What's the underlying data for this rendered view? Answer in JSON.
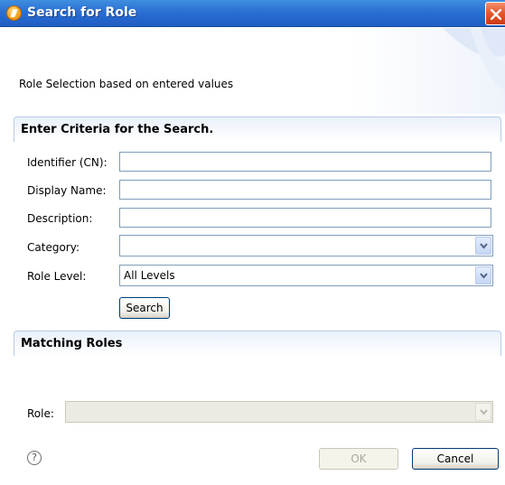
{
  "window": {
    "title": "Search for Role"
  },
  "intro": "Role Selection based on entered values",
  "criteria": {
    "header": "Enter Criteria for the Search.",
    "identifier_label": "Identifier (CN):",
    "identifier_value": "",
    "display_name_label": "Display Name:",
    "display_name_value": "",
    "description_label": "Description:",
    "description_value": "",
    "category_label": "Category:",
    "category_value": "",
    "role_level_label": "Role Level:",
    "role_level_value": "All Levels",
    "search_button": "Search"
  },
  "matching": {
    "header": "Matching Roles",
    "role_label": "Role:",
    "role_value": ""
  },
  "footer": {
    "help_glyph": "?",
    "ok_button": "OK",
    "cancel_button": "Cancel"
  },
  "colors": {
    "title_bar": "#2a6fd3",
    "close_button": "#e4552a",
    "section_border": "#b9cbe6"
  },
  "icons": {
    "title": "role-app-icon",
    "close": "close-icon",
    "dropdown": "chevron-down-icon",
    "help": "help-icon"
  }
}
